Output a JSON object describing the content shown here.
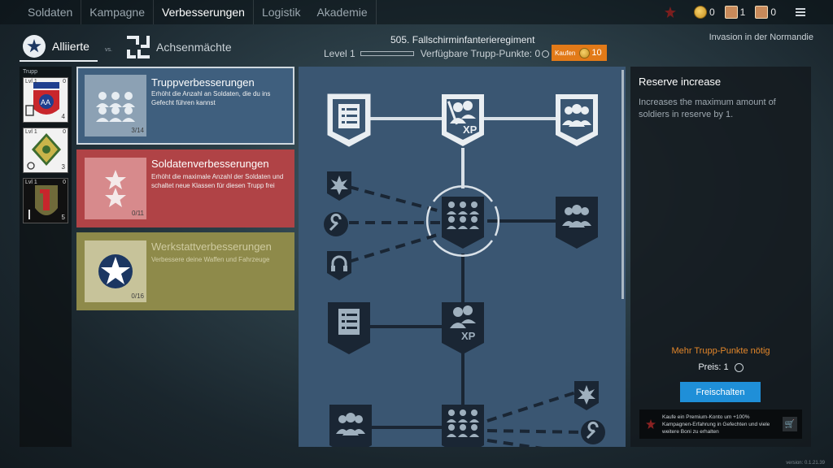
{
  "nav": {
    "items": [
      "Soldaten",
      "Kampagne",
      "Verbesserungen",
      "Logistik",
      "Akademie"
    ],
    "active": "Verbesserungen"
  },
  "resources": {
    "coins": "0",
    "cards_a": "1",
    "cards_b": "0"
  },
  "faction": {
    "allied": "Alliierte",
    "vs": "vs.",
    "axis": "Achsenmächte"
  },
  "regiment": {
    "name": "505. Fallschirminfanterieregiment",
    "level": "Level 1",
    "points_label": "Verfügbare Trupp-Punkte: 0",
    "level_progress": 0.0,
    "buy_label": "Kaufen",
    "buy_cost": "10"
  },
  "campaign": "Invasion in der Normandie",
  "squad": {
    "title": "Trupp",
    "cards": [
      {
        "level": "Lvl 1",
        "zero": "0",
        "count": "4"
      },
      {
        "level": "Lvl 1",
        "zero": "0",
        "count": "3"
      },
      {
        "level": "Lvl 1",
        "zero": "0",
        "count": "5"
      }
    ]
  },
  "categories": [
    {
      "title": "Truppverbesserungen",
      "desc": "Erhöht die Anzahl an Soldaten, die du ins Gefecht führen kannst",
      "progress": "3/14"
    },
    {
      "title": "Soldatenverbesserungen",
      "desc": "Erhöht die maximale Anzahl der Soldaten und schaltet neue Klassen für diesen Trupp frei",
      "progress": "0/11"
    },
    {
      "title": "Werkstattverbesserungen",
      "desc": "Verbessere deine Waffen und Fahrzeuge",
      "progress": "0/16"
    }
  ],
  "tree": {
    "xp_label": "XP"
  },
  "detail": {
    "title": "Reserve increase",
    "desc": "Increases the maximum amount of soldiers in reserve by 1.",
    "need_more": "Mehr Trupp-Punkte nötig",
    "price": "Preis: 1",
    "unlock": "Freischalten",
    "premium_text": "Kaufe ein Premium-Konto um +100% Kampagnen-Erfahrung in Gefechten und viele weitere Boni zu erhalten"
  },
  "version": "version: 0.1.21.39",
  "colors": {
    "accent_orange": "#e27a18",
    "unlock_blue": "#1f8fd8",
    "troop_blue": "#3f5f7e",
    "soldier_red": "#b04346",
    "workshop_olive": "#8e8a4a",
    "tree_bg": "#3a5672"
  }
}
